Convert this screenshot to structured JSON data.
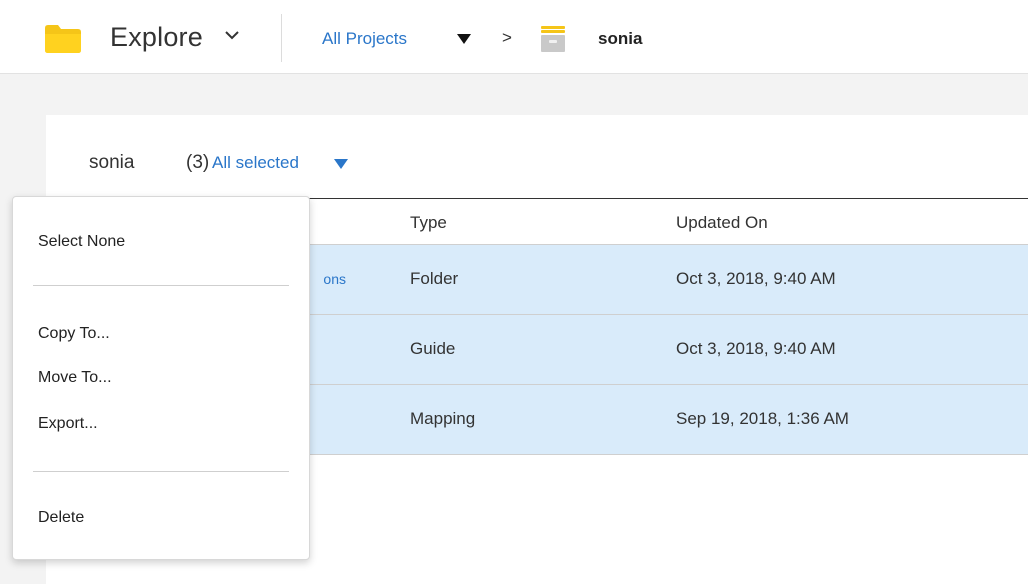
{
  "header": {
    "title": "Explore",
    "breadcrumb_root": "All Projects",
    "breadcrumb_separator": ">",
    "breadcrumb_current": "sonia"
  },
  "panel": {
    "title": "sonia",
    "count": "(3)",
    "selection_label": "All selected",
    "columns": {
      "type": "Type",
      "updated": "Updated On"
    },
    "rows": [
      {
        "name_fragment": "ons",
        "type": "Folder",
        "updated": "Oct 3, 2018, 9:40 AM",
        "selected": true
      },
      {
        "name_fragment": "",
        "type": "Guide",
        "updated": "Oct 3, 2018, 9:40 AM",
        "selected": true
      },
      {
        "name_fragment": "",
        "type": "Mapping",
        "updated": "Sep 19, 2018, 1:36 AM",
        "selected": true
      }
    ]
  },
  "menu": {
    "select_none": "Select None",
    "copy_to": "Copy To...",
    "move_to": "Move To...",
    "export": "Export...",
    "delete": "Delete"
  },
  "colors": {
    "accent": "#2a76c9",
    "folder_yellow": "#f5c518",
    "selected_row": "#d9ebfa"
  }
}
